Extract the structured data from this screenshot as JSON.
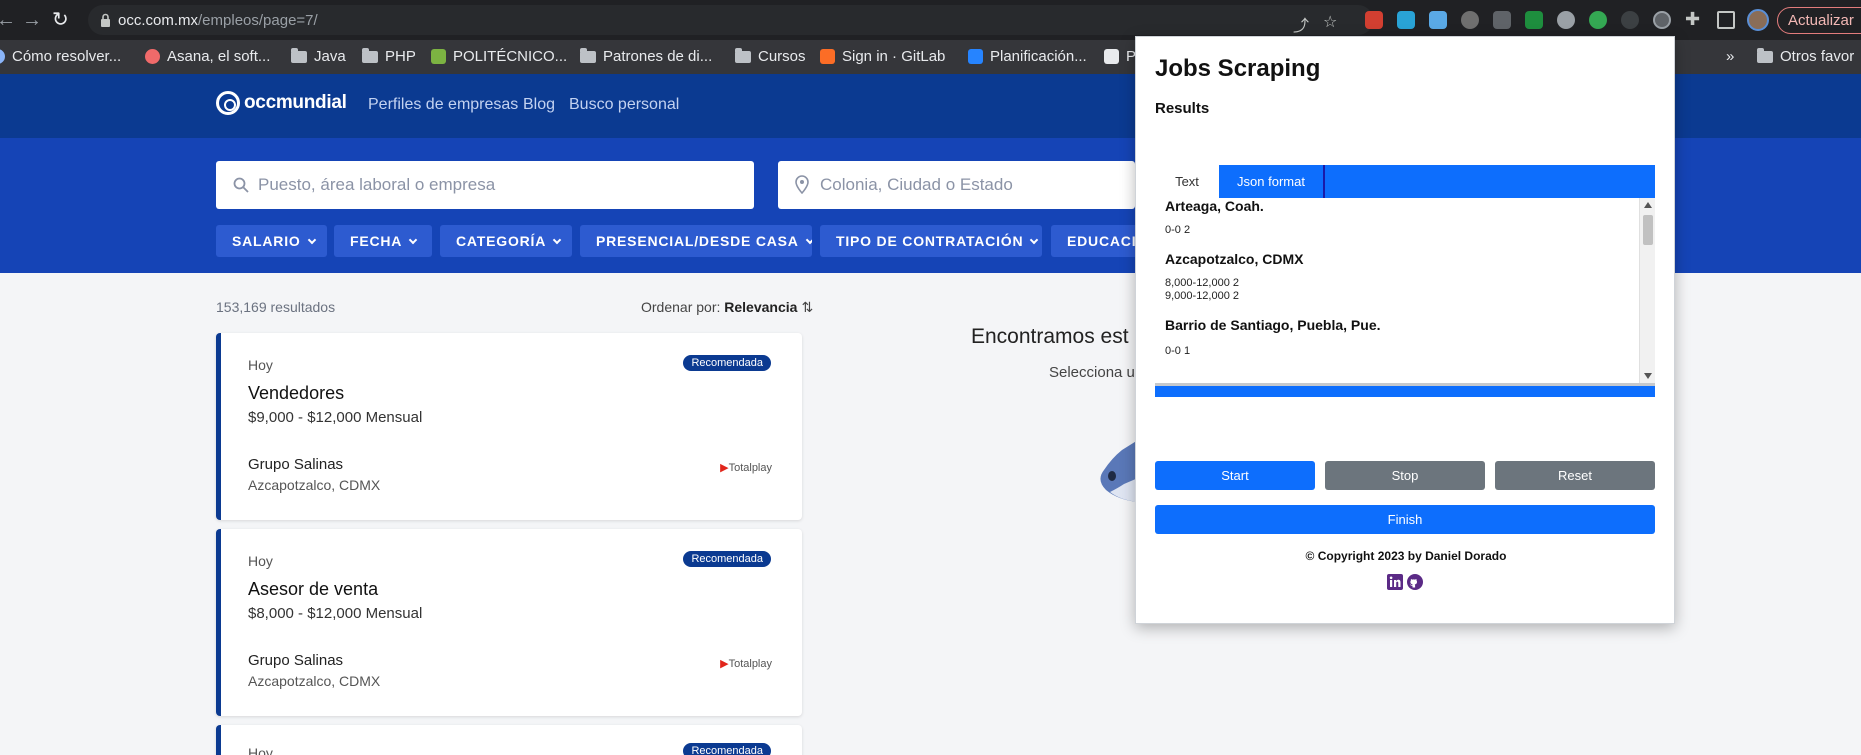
{
  "browser": {
    "url_host": "occ.com.mx",
    "url_path": "/empleos/page=7/",
    "update_label": "Actualizar",
    "bookmarks": [
      {
        "label": "Cómo resolver...",
        "icon": "globe-icon"
      },
      {
        "label": "Asana, el soft...",
        "icon": "asana-icon"
      },
      {
        "label": "Java",
        "icon": "folder-icon"
      },
      {
        "label": "PHP",
        "icon": "folder-icon"
      },
      {
        "label": "POLITÉCNICO...",
        "icon": "site-icon"
      },
      {
        "label": "Patrones de di...",
        "icon": "folder-icon"
      },
      {
        "label": "Cursos",
        "icon": "folder-icon"
      },
      {
        "label": "Sign in · GitLab",
        "icon": "gitlab-icon"
      },
      {
        "label": "Planificación...",
        "icon": "atlassian-icon"
      },
      {
        "label": "P",
        "icon": "site-icon"
      }
    ],
    "bookmarks_overflow": "»",
    "other_bookmarks": "Otros favor"
  },
  "site": {
    "nav": [
      "Perfiles de empresas",
      "Blog",
      "Busco personal"
    ],
    "search_placeholder": "Puesto, área laboral o empresa",
    "location_placeholder": "Colonia, Ciudad o Estado",
    "filters": [
      "SALARIO",
      "FECHA",
      "CATEGORÍA",
      "PRESENCIAL/DESDE CASA",
      "TIPO DE CONTRATACIÓN",
      "EDUCACIÓ"
    ],
    "results_count": "153,169 resultados",
    "sort_label": "Ordenar por:",
    "sort_value": "Relevancia",
    "jobs": [
      {
        "day": "Hoy",
        "badge": "Recomendada",
        "title": "Vendedores",
        "salary": "$9,000 - $12,000 Mensual",
        "company": "Grupo Salinas",
        "location": "Azcapotzalco, CDMX",
        "brand": "Totalplay"
      },
      {
        "day": "Hoy",
        "badge": "Recomendada",
        "title": "Asesor de venta",
        "salary": "$8,000 - $12,000 Mensual",
        "company": "Grupo Salinas",
        "location": "Azcapotzalco, CDMX",
        "brand": "Totalplay"
      },
      {
        "day": "Hoy",
        "badge": "Recomendada"
      }
    ],
    "empty_title": "Encontramos est",
    "empty_sub": "Selecciona u"
  },
  "popup": {
    "title": "Jobs Scraping",
    "subtitle": "Results",
    "tabs": [
      "Text",
      "Json format"
    ],
    "results": [
      {
        "location": "Arteaga, Coah.",
        "values": [
          "0-0 2"
        ]
      },
      {
        "location": "Azcapotzalco, CDMX",
        "values": [
          "8,000-12,000 2",
          "9,000-12,000 2"
        ]
      },
      {
        "location": "Barrio de Santiago, Puebla, Pue.",
        "values": [
          "0-0 1"
        ]
      }
    ],
    "buttons": {
      "start": "Start",
      "stop": "Stop",
      "reset": "Reset",
      "finish": "Finish"
    },
    "copyright": "© Copyright 2023 by Daniel Dorado",
    "colors": {
      "primary": "#0d6efd",
      "secondary": "#6c757d",
      "social": "#5b2a86"
    }
  }
}
